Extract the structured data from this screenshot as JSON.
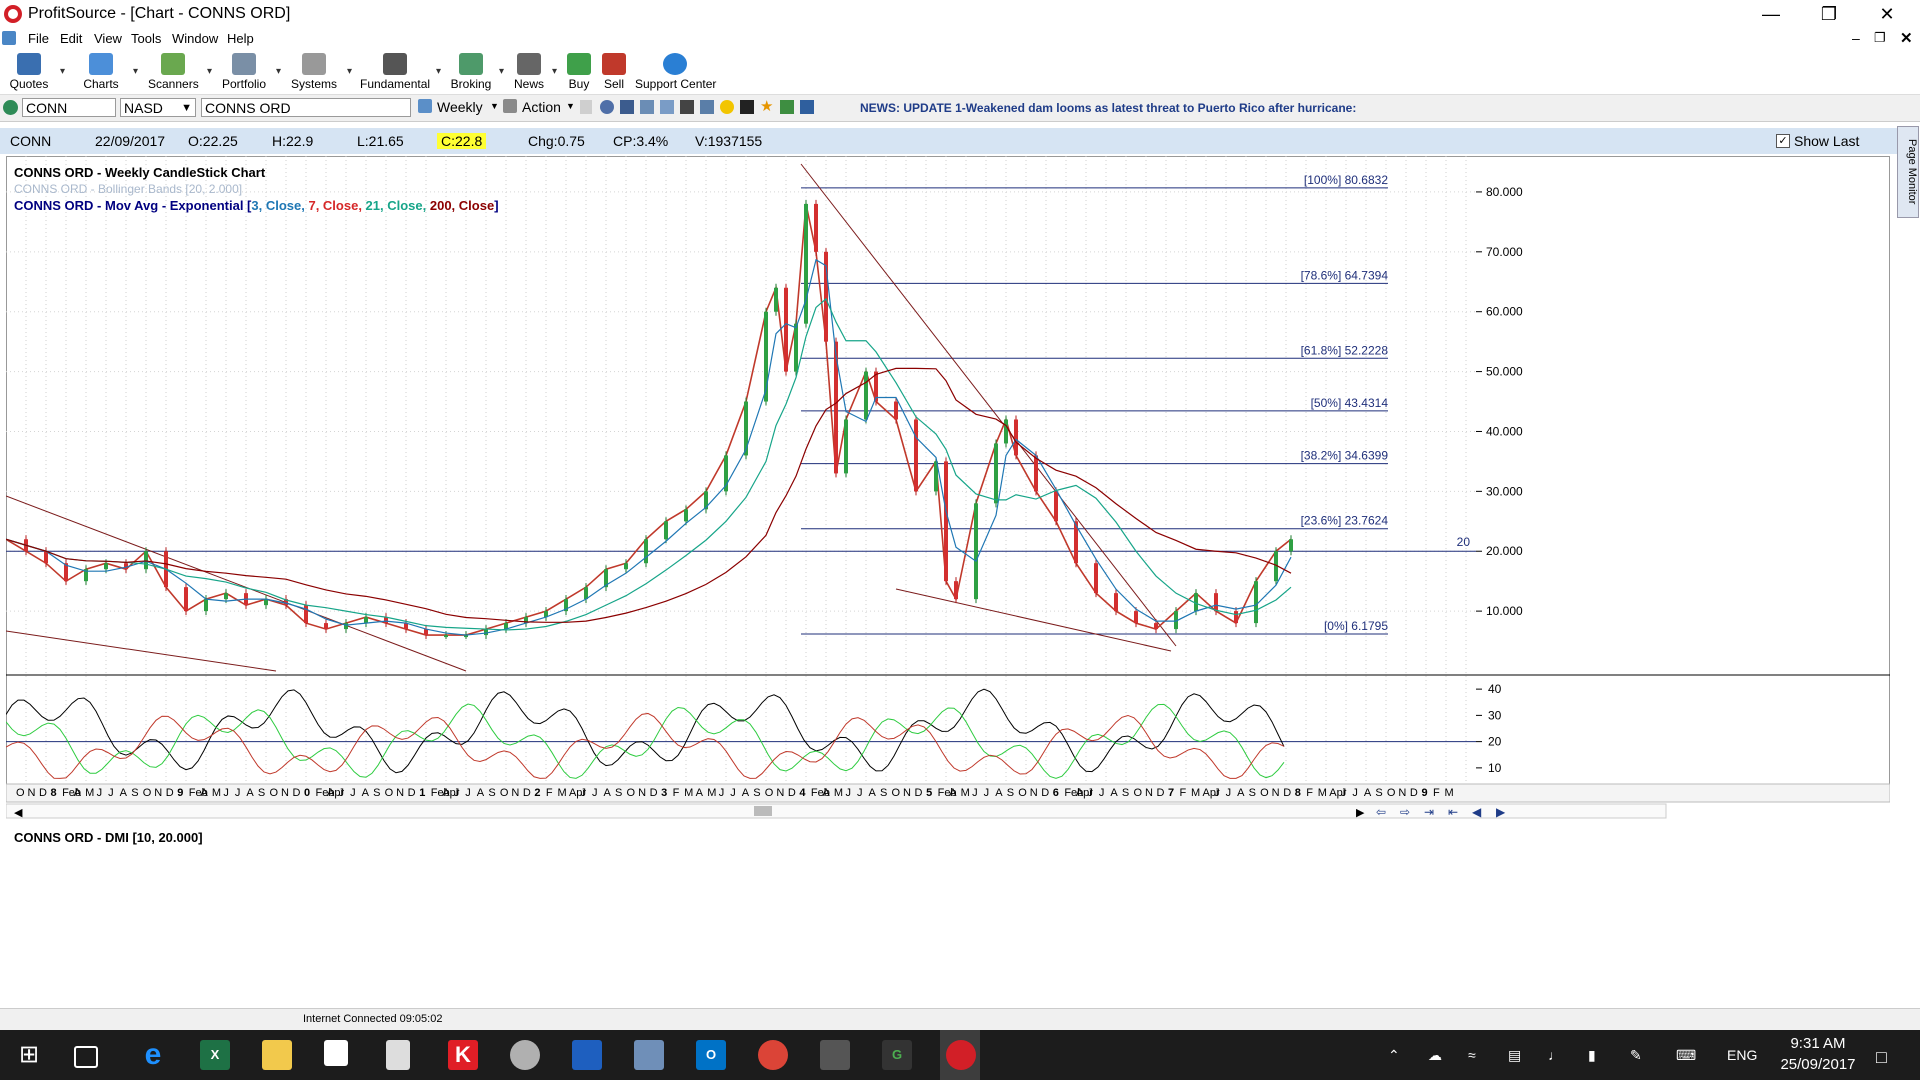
{
  "window": {
    "title": "ProfitSource - [Chart - CONNS ORD]"
  },
  "menu": [
    "File",
    "Edit",
    "View",
    "Tools",
    "Window",
    "Help"
  ],
  "toolbar": [
    {
      "label": "Quotes",
      "color": "#3a6fb0"
    },
    {
      "label": "Charts",
      "color": "#4c8fd9"
    },
    {
      "label": "Scanners",
      "color": "#6aa84f"
    },
    {
      "label": "Portfolio",
      "color": "#7a8fa6"
    },
    {
      "label": "Systems",
      "color": "#999999"
    },
    {
      "label": "Fundamental",
      "color": "#555555"
    },
    {
      "label": "Broking",
      "color": "#4e9a6a"
    },
    {
      "label": "News",
      "color": "#666666"
    },
    {
      "label": "Buy",
      "color": "#3fa04a"
    },
    {
      "label": "Sell",
      "color": "#c0392b"
    },
    {
      "label": "Support Center",
      "color": "#2a7fd4"
    }
  ],
  "symbolbar": {
    "symbol": "CONN",
    "exchange": "NASD",
    "name": "CONNS ORD",
    "period": "Weekly",
    "action": "Action",
    "news": "NEWS: UPDATE 1-Weakened dam looms as latest threat to Puerto Rico after hurricane:"
  },
  "info": {
    "symbol": "CONN",
    "date": "22/09/2017",
    "open": "O:22.25",
    "high": "H:22.9",
    "low": "L:21.65",
    "close": "C:22.8",
    "chg": "Chg:0.75",
    "cp": "CP:3.4%",
    "vol": "V:1937155",
    "show_last": "Show Last"
  },
  "legend": {
    "line1": "CONNS ORD - Weekly CandleStick Chart",
    "line2": "CONNS ORD - Bollinger Bands [20, 2.000]",
    "line3_prefix": "CONNS ORD - Mov Avg - Exponential [",
    "line3_items": [
      {
        "text": "3, Close, ",
        "color": "#1f77b4"
      },
      {
        "text": "7, Close, ",
        "color": "#d62728"
      },
      {
        "text": "21, Close, ",
        "color": "#17a589"
      },
      {
        "text": "200, Close",
        "color": "#8b0000"
      }
    ],
    "line3_suffix": "]",
    "dmi": "CONNS ORD - DMI [10, 20.000]"
  },
  "chart_data": {
    "type": "line",
    "y_ticks": [
      "80.000",
      "70.000",
      "60.000",
      "50.000",
      "40.000",
      "30.000",
      "20.000",
      "10.000"
    ],
    "dmi_ticks": [
      "40",
      "30",
      "20",
      "10"
    ],
    "fib_levels": [
      {
        "label": "[100%] 80.6832",
        "value": 80.6832
      },
      {
        "label": "[78.6%] 64.7394",
        "value": 64.7394
      },
      {
        "label": "[61.8%] 52.2228",
        "value": 52.2228
      },
      {
        "label": "[50%] 43.4314",
        "value": 43.4314
      },
      {
        "label": "[38.2%] 34.6399",
        "value": 34.6399
      },
      {
        "label": "[23.6%] 23.7624",
        "value": 23.7624
      },
      {
        "label": "[0%] 6.1795",
        "value": 6.1795
      }
    ],
    "hline_label": "20",
    "hline_value": 20,
    "price_path": [
      [
        0,
        22
      ],
      [
        20,
        20
      ],
      [
        40,
        18
      ],
      [
        60,
        15
      ],
      [
        80,
        17
      ],
      [
        100,
        18
      ],
      [
        120,
        17
      ],
      [
        140,
        20
      ],
      [
        160,
        14
      ],
      [
        180,
        10
      ],
      [
        200,
        12
      ],
      [
        220,
        13
      ],
      [
        240,
        11
      ],
      [
        260,
        12
      ],
      [
        280,
        11
      ],
      [
        300,
        8
      ],
      [
        320,
        7
      ],
      [
        340,
        8
      ],
      [
        360,
        9
      ],
      [
        380,
        8
      ],
      [
        400,
        7
      ],
      [
        420,
        6
      ],
      [
        440,
        6
      ],
      [
        460,
        6
      ],
      [
        480,
        7
      ],
      [
        500,
        8
      ],
      [
        520,
        9
      ],
      [
        540,
        10
      ],
      [
        560,
        12
      ],
      [
        580,
        14
      ],
      [
        600,
        17
      ],
      [
        620,
        18
      ],
      [
        640,
        22
      ],
      [
        660,
        25
      ],
      [
        680,
        27
      ],
      [
        700,
        30
      ],
      [
        720,
        36
      ],
      [
        740,
        45
      ],
      [
        760,
        60
      ],
      [
        770,
        64
      ],
      [
        780,
        50
      ],
      [
        790,
        58
      ],
      [
        800,
        78
      ],
      [
        810,
        70
      ],
      [
        820,
        55
      ],
      [
        830,
        33
      ],
      [
        840,
        42
      ],
      [
        860,
        50
      ],
      [
        870,
        45
      ],
      [
        890,
        42
      ],
      [
        910,
        30
      ],
      [
        930,
        35
      ],
      [
        940,
        15
      ],
      [
        950,
        12
      ],
      [
        970,
        28
      ],
      [
        990,
        38
      ],
      [
        1000,
        42
      ],
      [
        1010,
        36
      ],
      [
        1030,
        30
      ],
      [
        1050,
        25
      ],
      [
        1070,
        18
      ],
      [
        1090,
        13
      ],
      [
        1110,
        10
      ],
      [
        1130,
        8
      ],
      [
        1150,
        7
      ],
      [
        1170,
        10
      ],
      [
        1190,
        13
      ],
      [
        1210,
        10
      ],
      [
        1230,
        8
      ],
      [
        1250,
        15
      ],
      [
        1270,
        20
      ],
      [
        1285,
        22
      ]
    ],
    "x_tick_labels": [
      "O",
      "N",
      "D",
      "8",
      "Feb",
      "A",
      "M",
      "J",
      "J",
      "A",
      "S",
      "O",
      "N",
      "D",
      "9",
      "Feb",
      "A",
      "M",
      "J",
      "J",
      "A",
      "S",
      "O",
      "N",
      "D",
      "0",
      "Feb",
      "Apr",
      "J",
      "J",
      "A",
      "S",
      "O",
      "N",
      "D",
      "1",
      "Feb",
      "Apr",
      "J",
      "J",
      "A",
      "S",
      "O",
      "N",
      "D",
      "2",
      "F",
      "M",
      "Apr",
      "J",
      "J",
      "A",
      "S",
      "O",
      "N",
      "D",
      "3",
      "F",
      "M",
      "A",
      "M",
      "J",
      "J",
      "A",
      "S",
      "O",
      "N",
      "D",
      "4",
      "Feb",
      "A",
      "M",
      "J",
      "J",
      "A",
      "S",
      "O",
      "N",
      "D",
      "5",
      "Feb",
      "A",
      "M",
      "J",
      "J",
      "A",
      "S",
      "O",
      "N",
      "D",
      "6",
      "Feb",
      "Apr",
      "J",
      "J",
      "A",
      "S",
      "O",
      "N",
      "D",
      "7",
      "F",
      "M",
      "Apr",
      "J",
      "J",
      "A",
      "S",
      "O",
      "N",
      "D",
      "8",
      "F",
      "M",
      "Apr",
      "J",
      "J",
      "A",
      "S",
      "O",
      "N",
      "D",
      "9",
      "F",
      "M"
    ]
  },
  "status": {
    "text": "Internet Connected 09:05:02"
  },
  "taskbar": {
    "time": "9:31 AM",
    "date": "25/09/2017",
    "lang": "ENG"
  }
}
